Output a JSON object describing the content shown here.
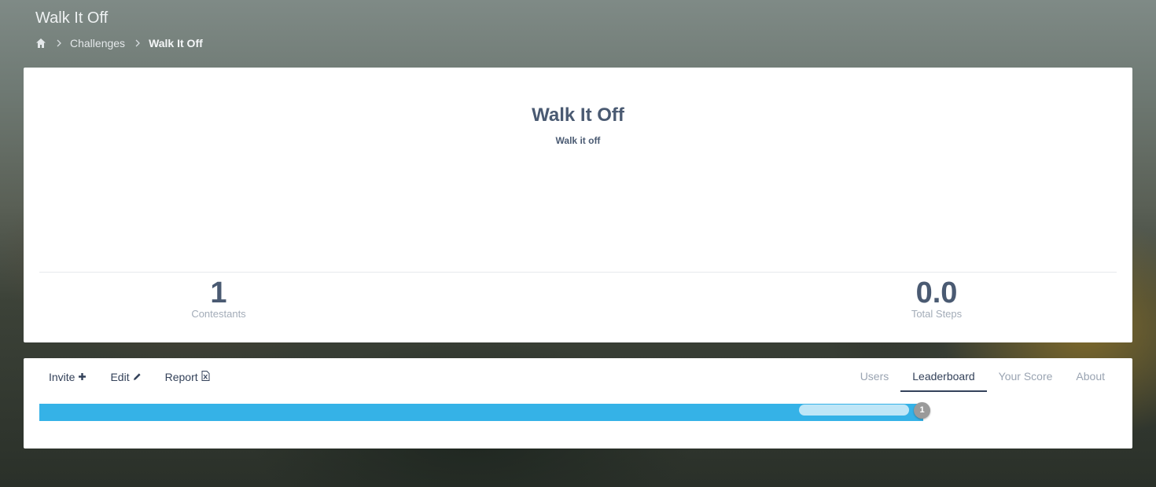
{
  "header": {
    "title": "Walk It Off",
    "breadcrumb": {
      "home_icon": "home-icon",
      "items": [
        "Challenges",
        "Walk It Off"
      ]
    }
  },
  "summary": {
    "title": "Walk It Off",
    "subtitle": "Walk it off",
    "stats": [
      {
        "value": "1",
        "label": "Contestants"
      },
      {
        "value": "0.0",
        "label": "Total Steps"
      }
    ]
  },
  "toolbar": {
    "invite_label": "Invite",
    "invite_icon": "plus-icon",
    "edit_label": "Edit",
    "edit_icon": "pencil-icon",
    "report_label": "Report",
    "report_icon": "excel-file-icon"
  },
  "tabs": [
    {
      "label": "Users",
      "active": false
    },
    {
      "label": "Leaderboard",
      "active": true
    },
    {
      "label": "Your Score",
      "active": false
    },
    {
      "label": "About",
      "active": false
    }
  ],
  "leaderboard": {
    "entries": [
      {
        "rank": "1",
        "progress": 1.0
      }
    ],
    "bar_color": "#35b2e7"
  },
  "colors": {
    "accent": "#34425a",
    "text": "#4a5a72",
    "muted": "#9aa4b2"
  }
}
